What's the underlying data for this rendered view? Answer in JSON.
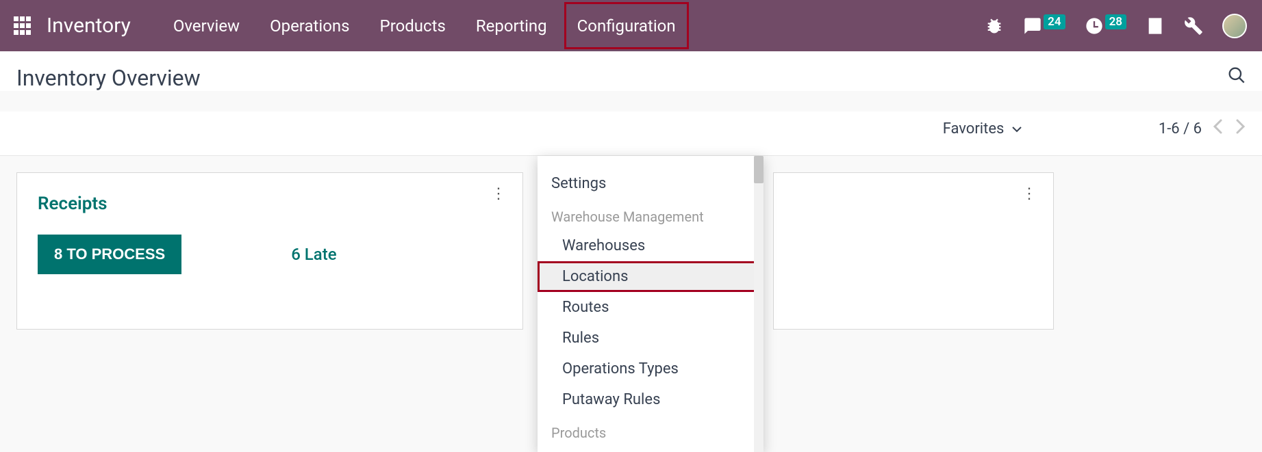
{
  "brand": "Inventory",
  "nav": {
    "overview": "Overview",
    "operations": "Operations",
    "products": "Products",
    "reporting": "Reporting",
    "configuration": "Configuration"
  },
  "tray": {
    "messages_badge": "24",
    "activities_badge": "28"
  },
  "page_title": "Inventory Overview",
  "toolbar": {
    "favorites": "Favorites",
    "pager_text": "1-6 / 6"
  },
  "dropdown": {
    "settings": "Settings",
    "section_warehouse": "Warehouse Management",
    "warehouses": "Warehouses",
    "locations": "Locations",
    "routes": "Routes",
    "rules": "Rules",
    "operations_types": "Operations Types",
    "putaway_rules": "Putaway Rules",
    "section_products": "Products"
  },
  "card": {
    "title": "Receipts",
    "process_label": "8 TO PROCESS",
    "late_label": "6 Late"
  }
}
